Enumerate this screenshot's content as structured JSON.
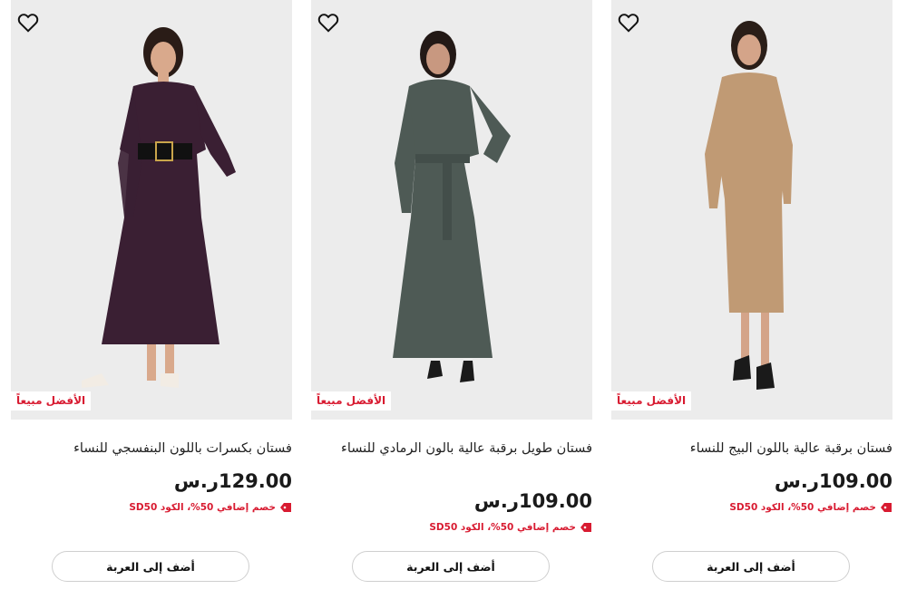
{
  "products": [
    {
      "title": "فستان بكسرات باللون البنفسجي للنساء",
      "price": "129.00",
      "currency": "ر.س",
      "promo": "خصم إضافي 50%، الكود SD50",
      "badge": "الأفضل مبيعاً",
      "cart_label": "أضف إلى العربة",
      "dress_color": "#3a1f33"
    },
    {
      "title": "فستان طويل برقبة عالية بالون الرمادي للنساء",
      "price": "109.00",
      "currency": "ر.س",
      "promo": "خصم إضافي 50%، الكود SD50",
      "badge": "الأفضل مبيعاً",
      "cart_label": "أضف إلى العربة",
      "dress_color": "#4e5a55"
    },
    {
      "title": "فستان برقبة عالية باللون البيج للنساء",
      "price": "109.00",
      "currency": "ر.س",
      "promo": "خصم إضافي 50%، الكود SD50",
      "badge": "الأفضل مبيعاً",
      "cart_label": "أضف إلى العربة",
      "dress_color": "#c09a74"
    }
  ],
  "colors": {
    "accent": "#d81b31",
    "image_bg": "#ececec"
  }
}
